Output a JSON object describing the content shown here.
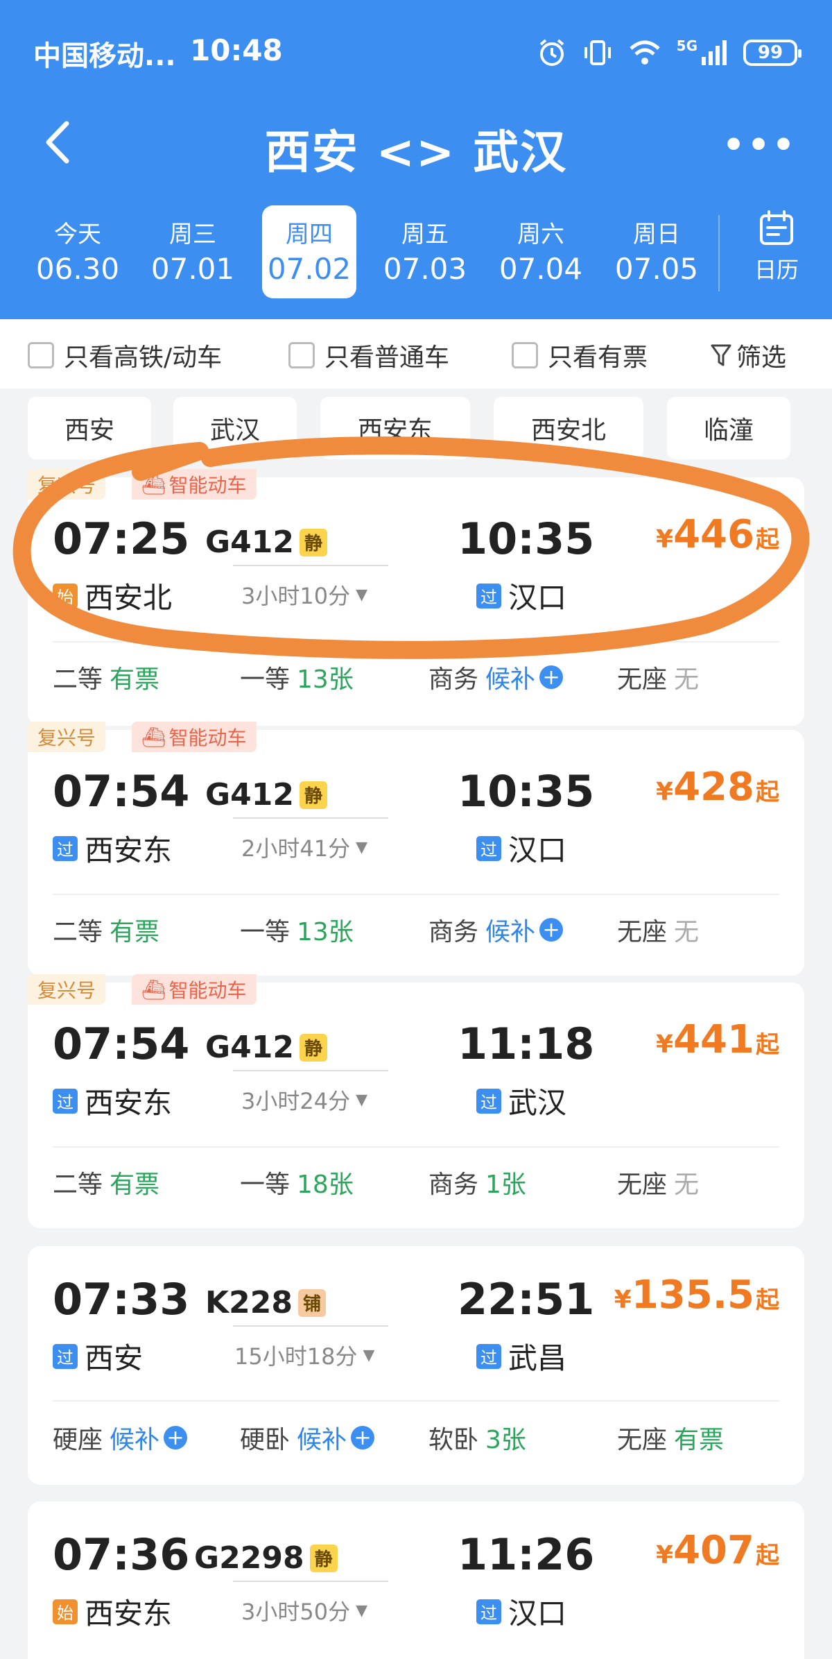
{
  "status": {
    "carrier": "中国移动...",
    "time": "10:48",
    "battery": "99",
    "network": "5G"
  },
  "nav": {
    "title": "西安 <> 武汉"
  },
  "dates": [
    {
      "dow": "今天",
      "date": "06.30"
    },
    {
      "dow": "周三",
      "date": "07.01"
    },
    {
      "dow": "周四",
      "date": "07.02",
      "active": true
    },
    {
      "dow": "周五",
      "date": "07.03"
    },
    {
      "dow": "周六",
      "date": "07.04"
    },
    {
      "dow": "周日",
      "date": "07.05"
    }
  ],
  "calendar_label": "日历",
  "filters": {
    "high_speed": "只看高铁/动车",
    "normal": "只看普通车",
    "has_ticket": "只看有票",
    "filter": "筛选"
  },
  "stations": [
    "西安",
    "武汉",
    "西安东",
    "西安北",
    "临潼"
  ],
  "trains": [
    {
      "tags": [
        "复兴号",
        "智能动车"
      ],
      "dep_time": "07:25",
      "dep_station": "西安北",
      "dep_badge": "始",
      "train_no": "G412",
      "seat_type": "静",
      "duration": "3小时10分",
      "arr_time": "10:35",
      "arr_station": "汉口",
      "arr_badge": "过",
      "price_cur": "¥",
      "price": "446",
      "price_suffix": "起",
      "seats": [
        {
          "name": "二等",
          "value": "有票"
        },
        {
          "name": "一等",
          "value": "13张"
        },
        {
          "name": "商务",
          "value": "候补"
        },
        {
          "name": "无座",
          "value": "无"
        }
      ]
    },
    {
      "tags": [
        "复兴号",
        "智能动车"
      ],
      "dep_time": "07:54",
      "dep_station": "西安东",
      "dep_badge": "过",
      "train_no": "G412",
      "seat_type": "静",
      "duration": "2小时41分",
      "arr_time": "10:35",
      "arr_station": "汉口",
      "arr_badge": "过",
      "price_cur": "¥",
      "price": "428",
      "price_suffix": "起",
      "seats": [
        {
          "name": "二等",
          "value": "有票"
        },
        {
          "name": "一等",
          "value": "13张"
        },
        {
          "name": "商务",
          "value": "候补"
        },
        {
          "name": "无座",
          "value": "无"
        }
      ]
    },
    {
      "tags": [
        "复兴号",
        "智能动车"
      ],
      "dep_time": "07:54",
      "dep_station": "西安东",
      "dep_badge": "过",
      "train_no": "G412",
      "seat_type": "静",
      "duration": "3小时24分",
      "arr_time": "11:18",
      "arr_station": "武汉",
      "arr_badge": "过",
      "price_cur": "¥",
      "price": "441",
      "price_suffix": "起",
      "seats": [
        {
          "name": "二等",
          "value": "有票"
        },
        {
          "name": "一等",
          "value": "18张"
        },
        {
          "name": "商务",
          "value": "1张"
        },
        {
          "name": "无座",
          "value": "无"
        }
      ]
    },
    {
      "tags": [],
      "dep_time": "07:33",
      "dep_station": "西安",
      "dep_badge": "过",
      "train_no": "K228",
      "seat_type": "铺",
      "duration": "15小时18分",
      "arr_time": "22:51",
      "arr_station": "武昌",
      "arr_badge": "过",
      "price_cur": "¥",
      "price": "135.5",
      "price_suffix": "起",
      "seats": [
        {
          "name": "硬座",
          "value": "候补"
        },
        {
          "name": "硬卧",
          "value": "候补"
        },
        {
          "name": "软卧",
          "value": "3张"
        },
        {
          "name": "无座",
          "value": "有票"
        }
      ]
    },
    {
      "tags": [],
      "dep_time": "07:36",
      "dep_station": "西安东",
      "dep_badge": "始",
      "train_no": "G2298",
      "seat_type": "静",
      "duration": "3小时50分",
      "arr_time": "11:26",
      "arr_station": "汉口",
      "arr_badge": "过",
      "price_cur": "¥",
      "price": "407",
      "price_suffix": "起",
      "seats": []
    }
  ],
  "colors": {
    "header": "#3c8ff0",
    "price": "#f07a21",
    "available": "#2aa55b",
    "waitlist": "#2f86e8",
    "annotation": "#f08a3c"
  }
}
